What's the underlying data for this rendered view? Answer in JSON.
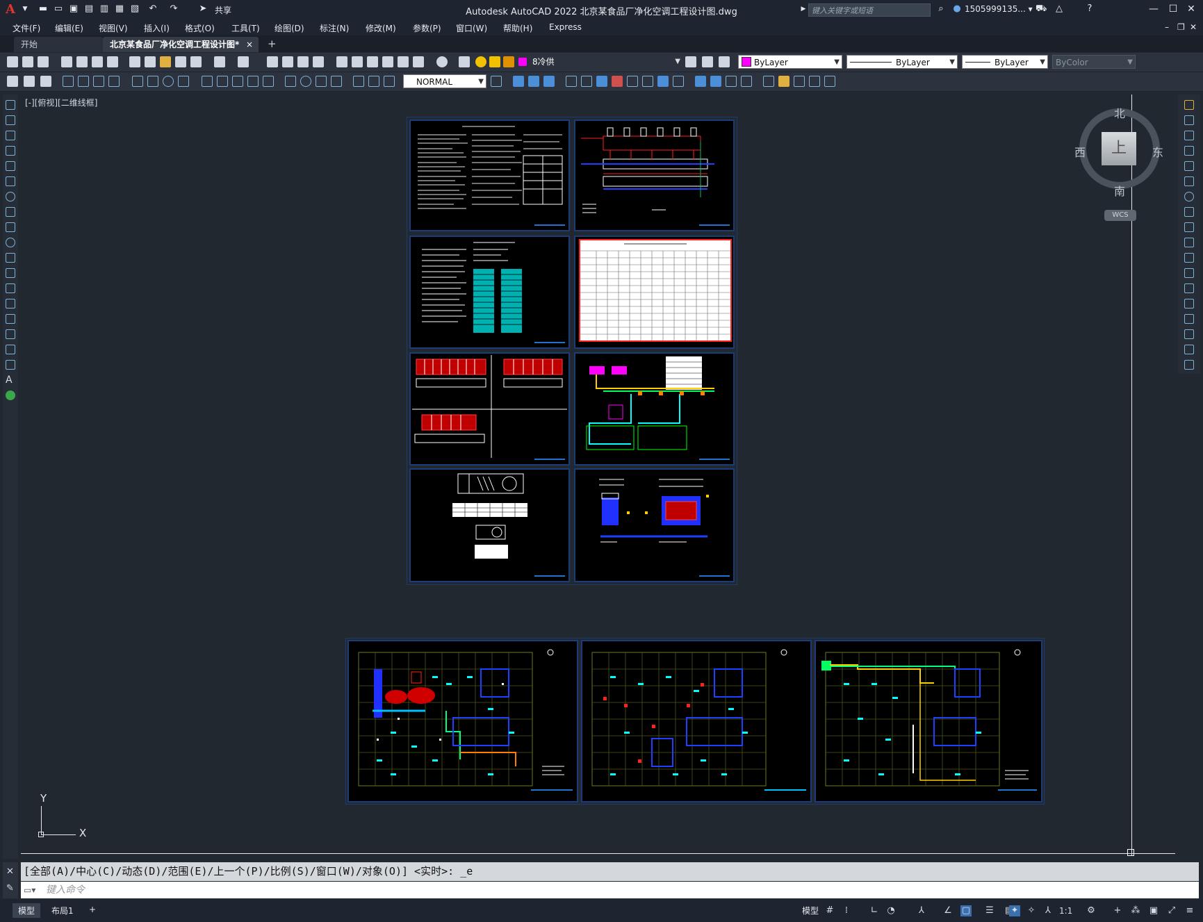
{
  "window": {
    "title": "Autodesk AutoCAD 2022    北京某食品厂净化空调工程设计图.dwg",
    "share_label": "共享",
    "search_placeholder": "键入关键字或短语",
    "user": "1505999135... ▾"
  },
  "menus": [
    "文件(F)",
    "编辑(E)",
    "视图(V)",
    "插入(I)",
    "格式(O)",
    "工具(T)",
    "绘图(D)",
    "标注(N)",
    "修改(M)",
    "参数(P)",
    "窗口(W)",
    "帮助(H)",
    "Express"
  ],
  "tabs": {
    "start": "开始",
    "active": "北京某食品厂净化空调工程设计图*",
    "close": "×",
    "add": "+"
  },
  "properties": {
    "layer": "8冷供",
    "color": "ByLayer",
    "linetype": "ByLayer",
    "lineweight": "ByLayer",
    "plotstyle": "ByColor",
    "textstyle": "NORMAL",
    "layer_swatch": "#ff00ff"
  },
  "viewport": {
    "label": "[-][俯视][二维线框]",
    "cube_face": "上",
    "north": "北",
    "south": "南",
    "east": "东",
    "west": "西",
    "wcs": "WCS",
    "ucs_x": "X",
    "ucs_y": "Y"
  },
  "command": {
    "history": "[全部(A)/中心(C)/动态(D)/范围(E)/上一个(P)/比例(S)/窗口(W)/对象(O)] <实时>: _e",
    "placeholder": "键入命令"
  },
  "status": {
    "model_tab": "模型",
    "layout_tab": "布局1",
    "model_label": "模型",
    "scale": "1:1"
  }
}
